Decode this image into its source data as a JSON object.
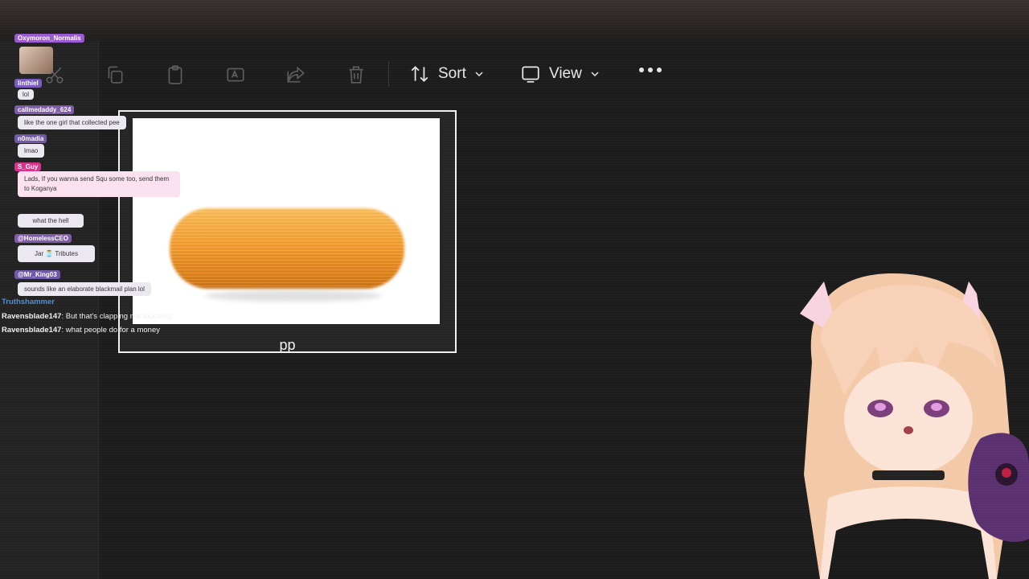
{
  "toolbar": {
    "icons": [
      "cut-icon",
      "copy-icon",
      "paste-icon",
      "rename-icon",
      "share-icon",
      "delete-icon"
    ],
    "sort_label": "Sort",
    "view_label": "View"
  },
  "file_tile": {
    "label": "pp",
    "thumbnail": "sausage-image"
  },
  "chat": {
    "cards": [
      {
        "user": "Oxymoron_Normalis",
        "message": "",
        "color": "#9b59d0"
      },
      {
        "user": "linthiel",
        "message": "lol",
        "color": "#7a5bbf"
      },
      {
        "user": "callmedaddy_624",
        "message": "like the one girl that collected pee",
        "color": "#7e5aa8"
      },
      {
        "user": "n0madia",
        "message": "lmao",
        "color": "#6f58a8"
      },
      {
        "user": "S_Guy",
        "message": "Lads, If you wanna send Squ some too, send them to Koganya",
        "color": "#d6338a"
      },
      {
        "user": "",
        "message": "what the hell",
        "color": "#888888"
      },
      {
        "user": "@HomelessCEO",
        "message": "Jar 🫙 Tributes",
        "color": "#7e5aa8"
      },
      {
        "user": "@Mr_King03",
        "message": "sounds like an elaborate blackmail plan lol",
        "color": "#6f58a8"
      }
    ],
    "lines": [
      {
        "user": "Truthshammer",
        "message": ""
      },
      {
        "user": "Ravensblade147",
        "message": "But that's clapping not touching"
      },
      {
        "user": "Ravensblade147",
        "message": "what people do for a money"
      }
    ]
  },
  "colors": {
    "background": "#1c1c1c",
    "tile_border": "#f0f0f0",
    "sausage": "#eb9a30"
  }
}
